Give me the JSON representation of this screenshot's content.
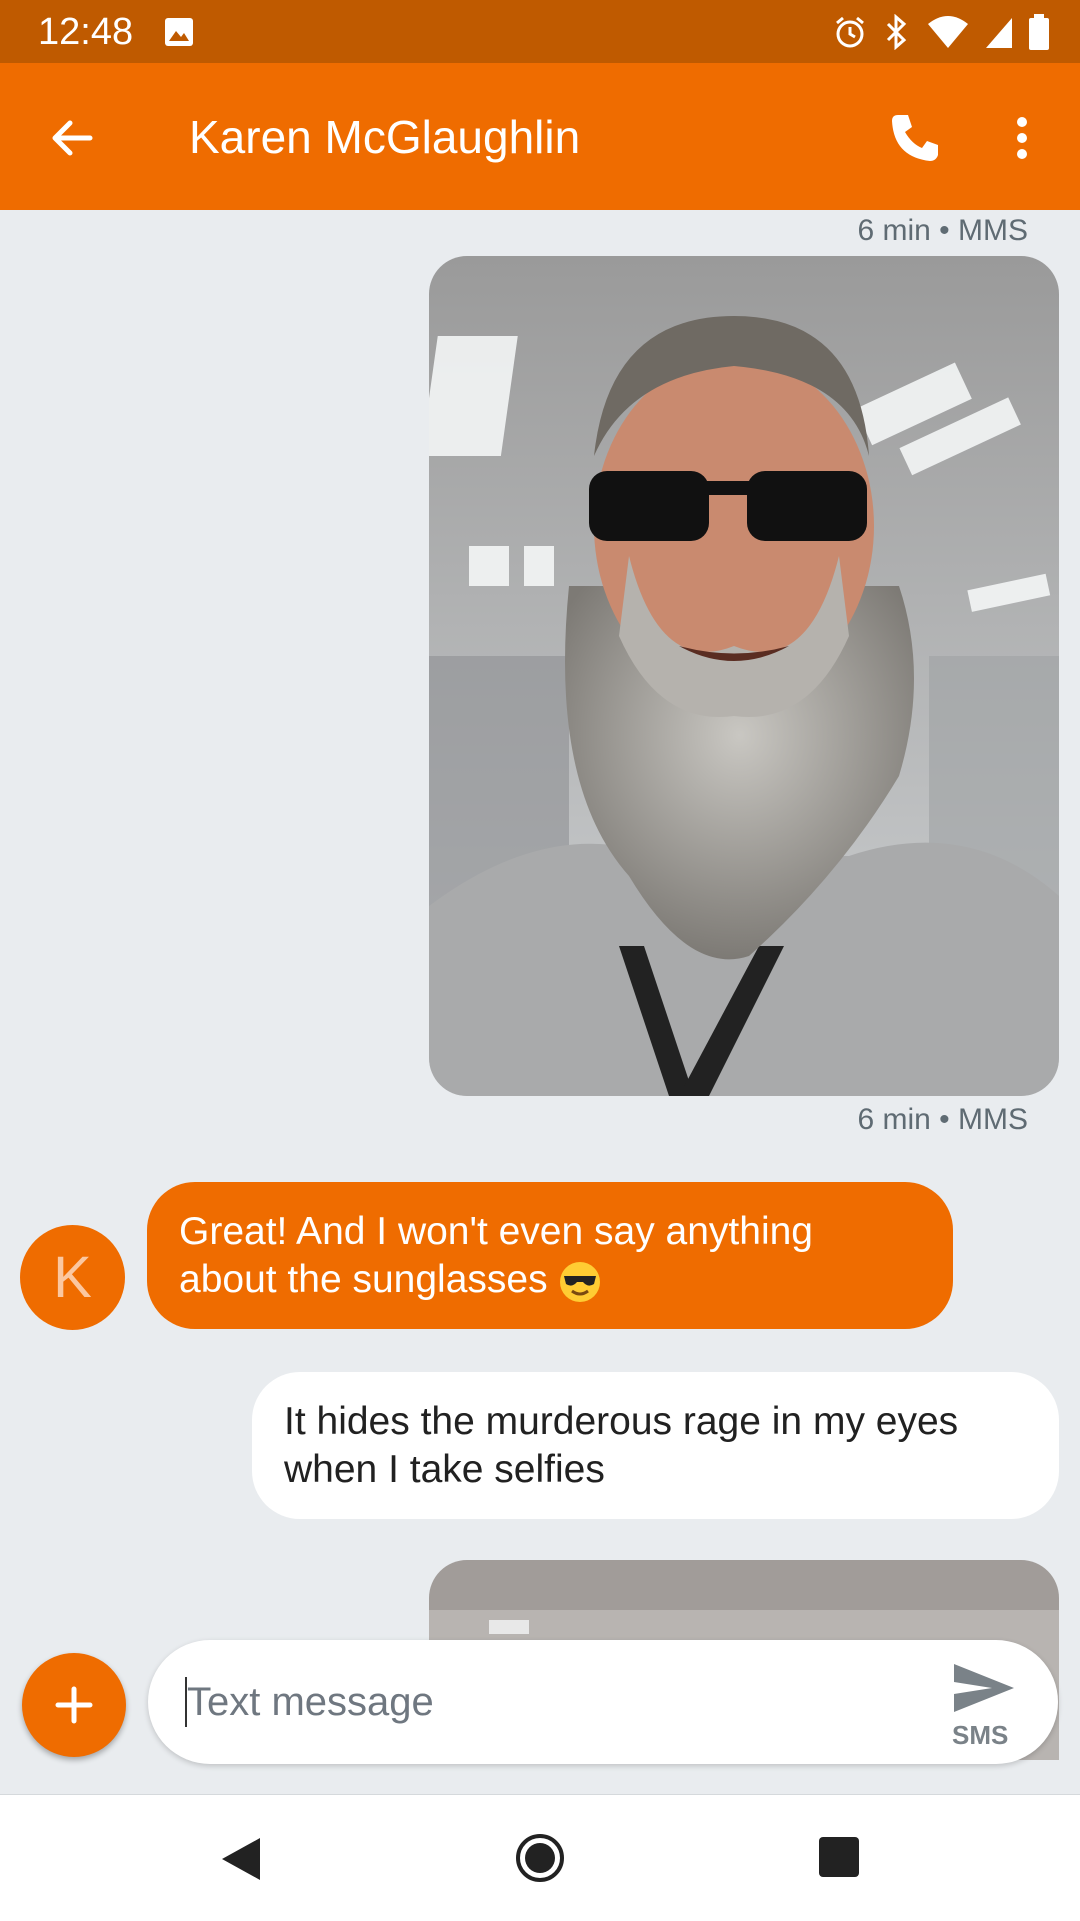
{
  "status_bar": {
    "time": "12:48"
  },
  "header": {
    "contact_name": "Karen McGlaughlin"
  },
  "messages": [
    {
      "type": "meta",
      "text": "6 min • MMS"
    },
    {
      "type": "image",
      "alt": "Selfie of bearded man wearing sunglasses"
    },
    {
      "type": "meta",
      "text": "6 min • MMS"
    },
    {
      "type": "incoming",
      "avatar_letter": "K",
      "text": "Great! And I won't even say anything about the sunglasses"
    },
    {
      "type": "outgoing",
      "text": "It hides the murderous rage in my eyes when I take selfies"
    },
    {
      "type": "image",
      "alt": "Partial photo"
    }
  ],
  "compose": {
    "placeholder": "Text message",
    "send_sublabel": "SMS"
  },
  "colors": {
    "status_bar": "#bf5a00",
    "accent": "#ef6c00",
    "background": "#e9ecef"
  }
}
